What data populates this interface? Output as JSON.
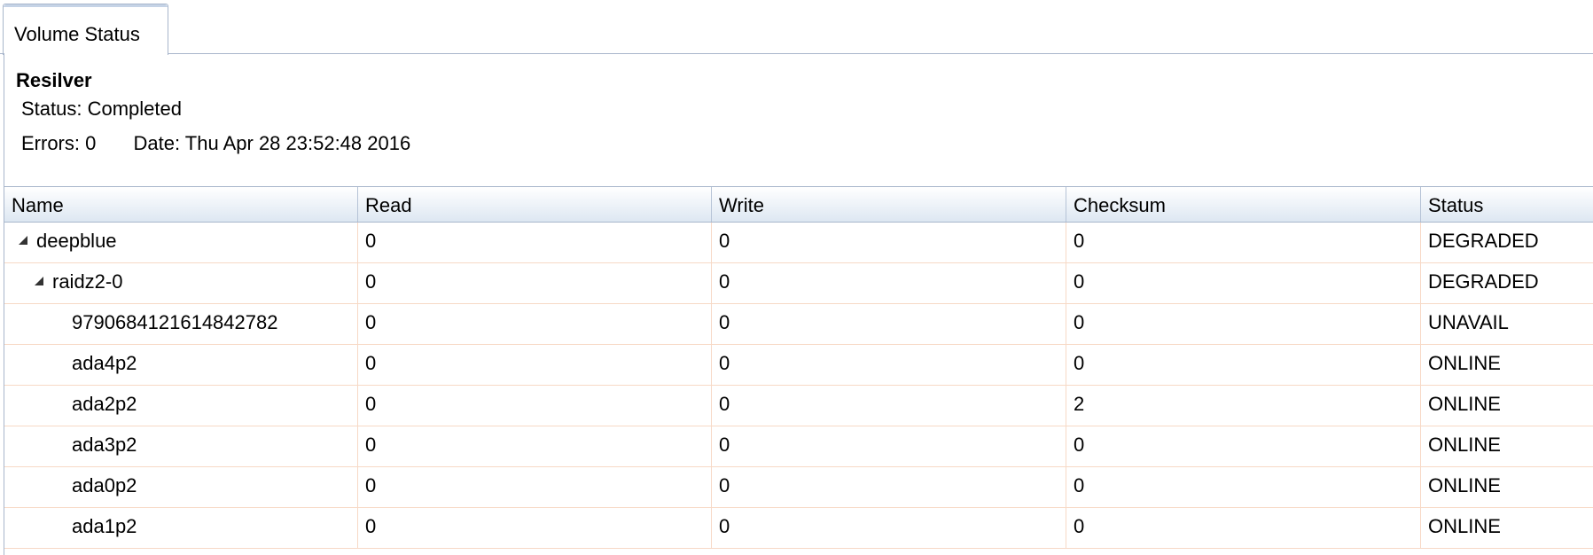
{
  "tab": {
    "label": "Volume Status"
  },
  "resilver": {
    "title": "Resilver",
    "status_text": "Status: Completed",
    "errors_text": "Errors: 0",
    "date_text": "Date: Thu Apr 28 23:52:48 2016"
  },
  "table": {
    "columns": [
      "Name",
      "Read",
      "Write",
      "Checksum",
      "Status"
    ],
    "rows": [
      {
        "name": "deepblue",
        "read": "0",
        "write": "0",
        "checksum": "0",
        "status": "DEGRADED"
      },
      {
        "name": "raidz2-0",
        "read": "0",
        "write": "0",
        "checksum": "0",
        "status": "DEGRADED"
      },
      {
        "name": "9790684121614842782",
        "read": "0",
        "write": "0",
        "checksum": "0",
        "status": "UNAVAIL"
      },
      {
        "name": "ada4p2",
        "read": "0",
        "write": "0",
        "checksum": "0",
        "status": "ONLINE"
      },
      {
        "name": "ada2p2",
        "read": "0",
        "write": "0",
        "checksum": "2",
        "status": "ONLINE"
      },
      {
        "name": "ada3p2",
        "read": "0",
        "write": "0",
        "checksum": "0",
        "status": "ONLINE"
      },
      {
        "name": "ada0p2",
        "read": "0",
        "write": "0",
        "checksum": "0",
        "status": "ONLINE"
      },
      {
        "name": "ada1p2",
        "read": "0",
        "write": "0",
        "checksum": "0",
        "status": "ONLINE"
      }
    ]
  }
}
